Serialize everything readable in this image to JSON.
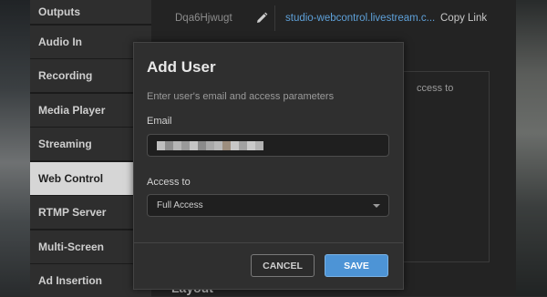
{
  "sidebar": {
    "items": [
      {
        "label": "Outputs"
      },
      {
        "label": "Audio In"
      },
      {
        "label": "Recording"
      },
      {
        "label": "Media Player"
      },
      {
        "label": "Streaming"
      },
      {
        "label": "Web Control"
      },
      {
        "label": "RTMP Server"
      },
      {
        "label": "Multi-Screen"
      },
      {
        "label": "Ad Insertion"
      }
    ],
    "active_index": 5
  },
  "control_row": {
    "key": "Dqa6Hjwugt",
    "link": "studio-webcontrol.livestream.c...",
    "copy_label": "Copy Link",
    "link_color": "#5ea0d8"
  },
  "users_table": {
    "column_partial": "ccess to"
  },
  "layout_heading": "Layout",
  "modal": {
    "title": "Add User",
    "subtitle": "Enter user's email and access parameters",
    "email_label": "Email",
    "email_value_redacted": true,
    "access_label": "Access to",
    "access_value": "Full Access",
    "cancel_label": "CANCEL",
    "save_label": "SAVE",
    "accent_color": "#4d94d6"
  }
}
